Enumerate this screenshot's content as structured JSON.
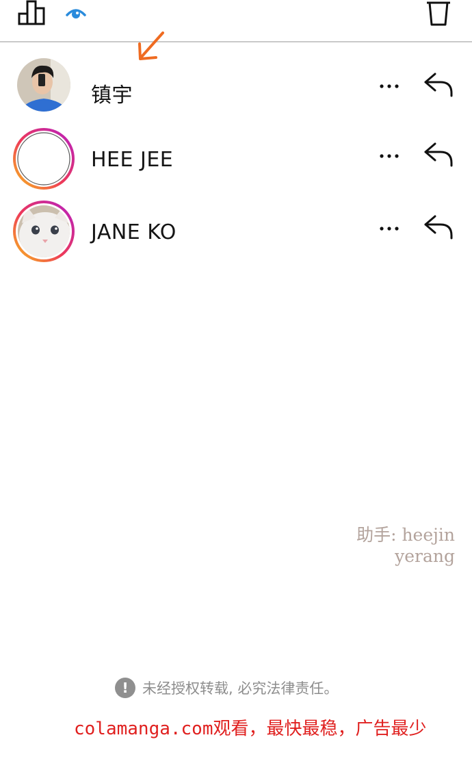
{
  "toolbar": {
    "stats_icon": "bar-chart-icon",
    "eye_icon": "eye-icon",
    "trash_icon": "trash-icon",
    "accent_color": "#2a8bdc"
  },
  "viewers": [
    {
      "name": "镇宇",
      "avatar": "photo-man-blue-shirt",
      "story_ring": false
    },
    {
      "name": "HEE JEE",
      "avatar": "blank-white",
      "story_ring": true
    },
    {
      "name": "JANE KO",
      "avatar": "photo-white-cat",
      "story_ring": true
    }
  ],
  "row_actions": {
    "more_icon": "more-dots-icon",
    "reply_icon": "reply-arrow-icon"
  },
  "annotation": {
    "arrow_color": "#ef6b21"
  },
  "credit": {
    "line1": "助手: heejin",
    "line2": "yerang"
  },
  "notice": {
    "text": "未经授权转载, 必究法律责任。"
  },
  "ad": {
    "text": "colamanga.com观看，最快最稳，广告最少"
  }
}
